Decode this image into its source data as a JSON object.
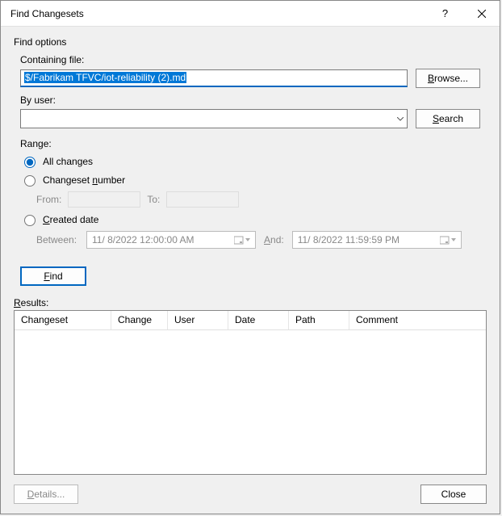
{
  "title": "Find Changesets",
  "findOptions": {
    "groupLabel": "Find options",
    "containingFile": {
      "label": "Containing file:",
      "value": "$/Fabrikam TFVC/iot-reliability (2).md",
      "browse": "Browse..."
    },
    "byUser": {
      "label": "By user:",
      "value": "",
      "search": "Search"
    },
    "range": {
      "label": "Range:",
      "all": "All changes",
      "number": "Changeset number",
      "from": "From:",
      "to": "To:",
      "created": "Created date",
      "between": "Between:",
      "and": "And:",
      "date1": "11/  8/2022 12:00:00 AM",
      "date2": "11/  8/2022 11:59:59 PM"
    },
    "findBtn": "Find"
  },
  "results": {
    "label": "Results:",
    "columns": [
      "Changeset",
      "Change",
      "User",
      "Date",
      "Path",
      "Comment"
    ]
  },
  "footer": {
    "details": "Details...",
    "close": "Close"
  }
}
